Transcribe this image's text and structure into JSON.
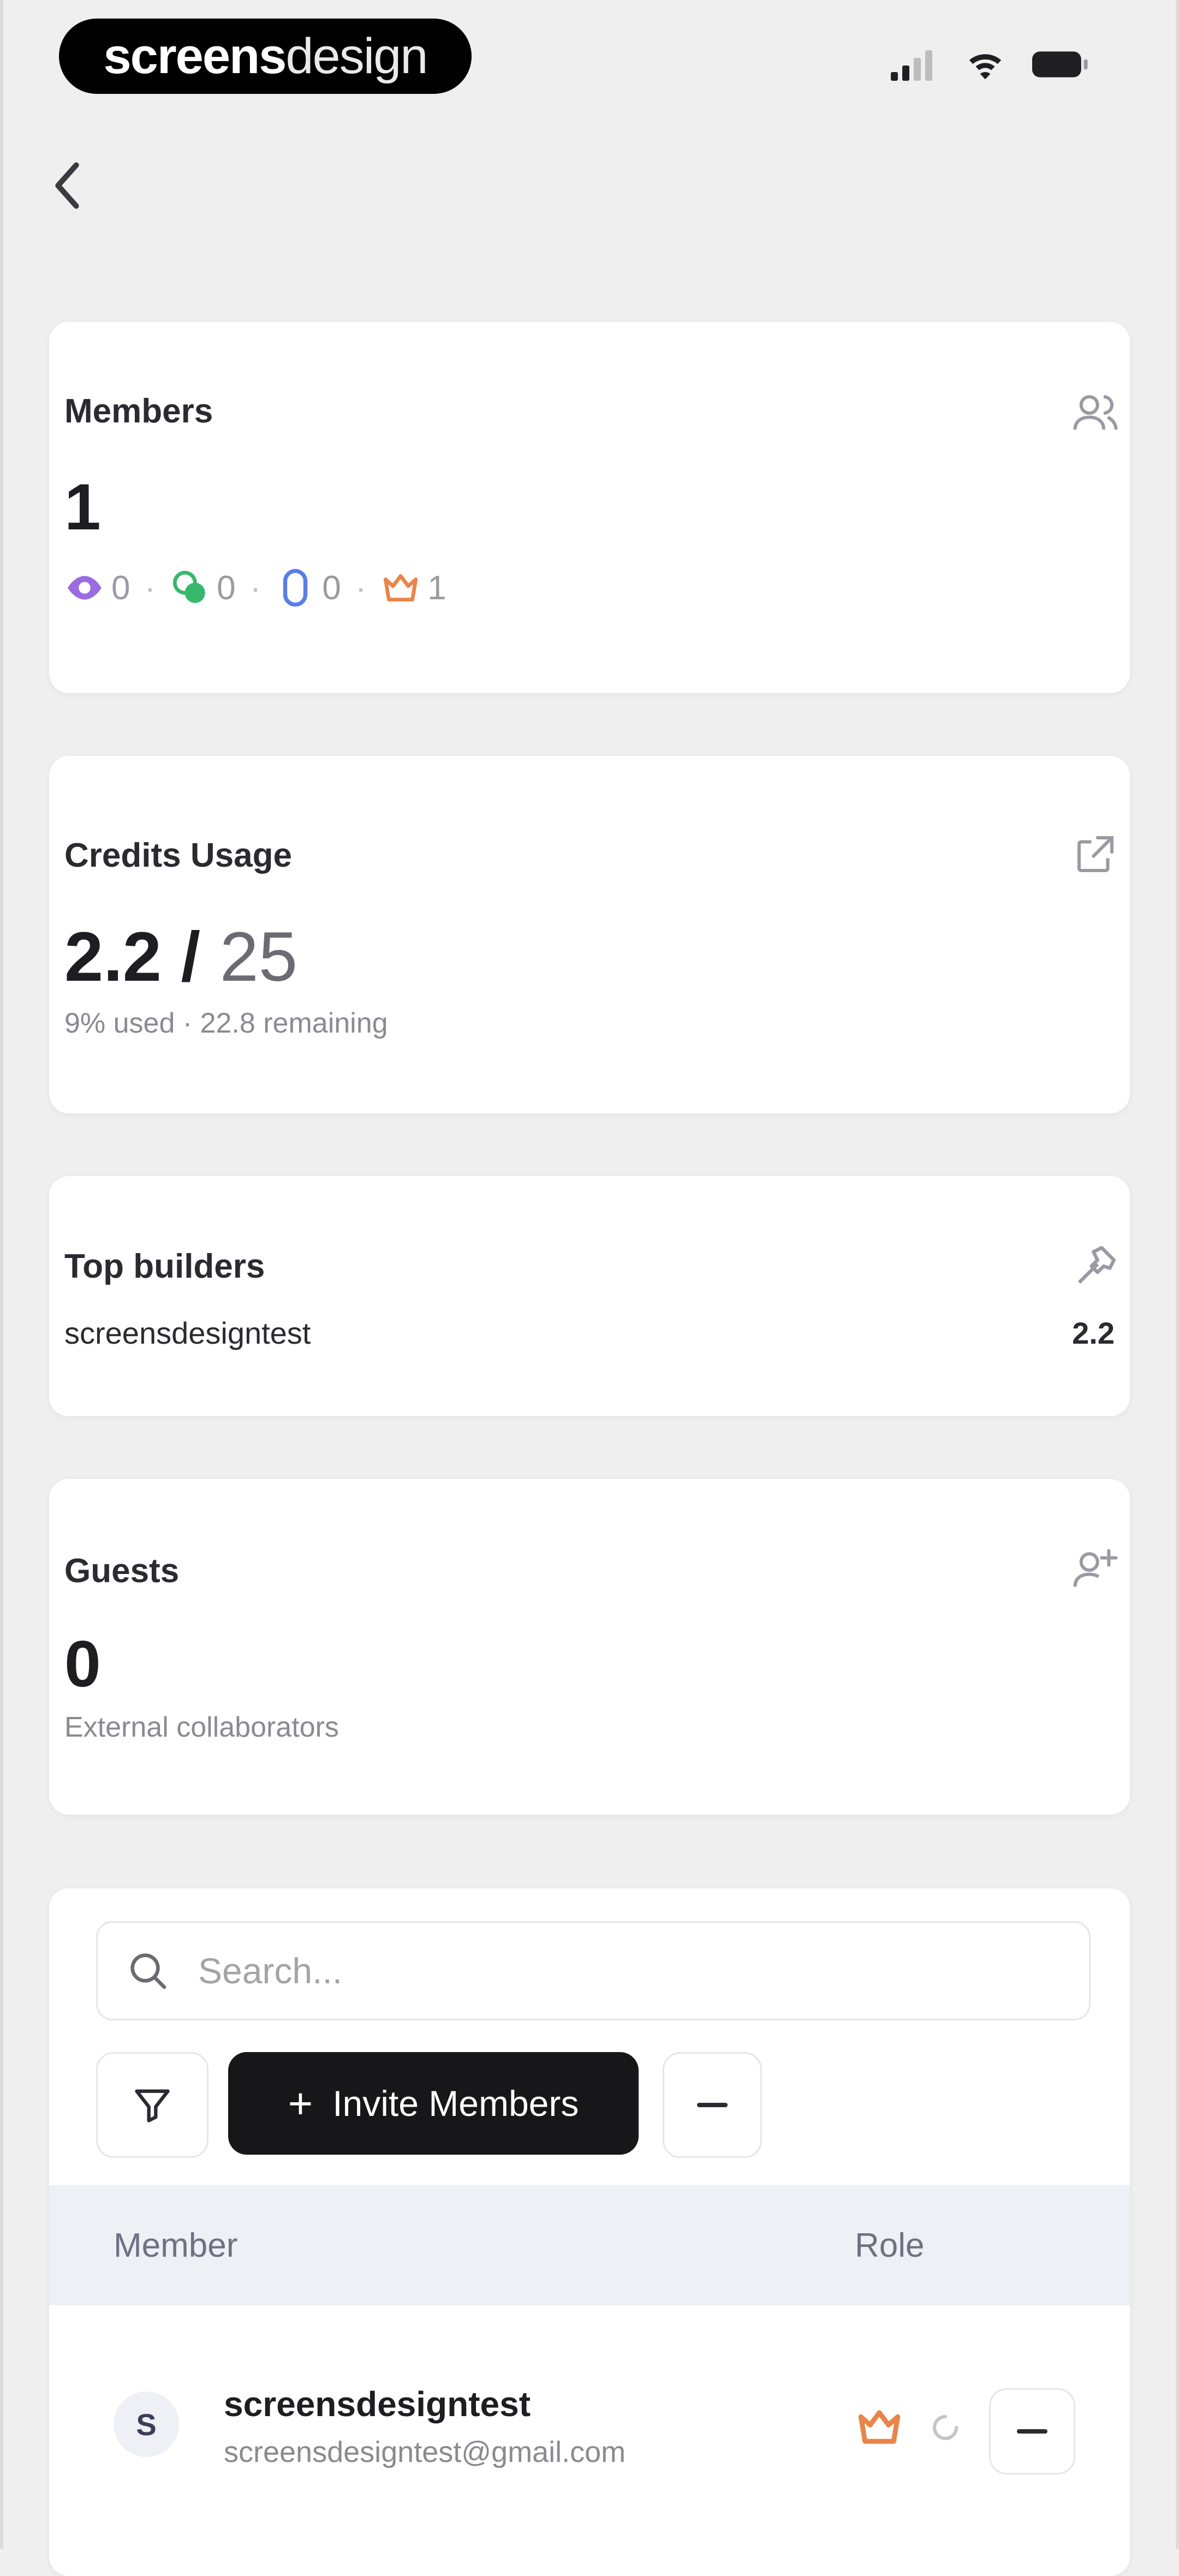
{
  "status_bar": {
    "brand_bold": "screens",
    "brand_light": "design"
  },
  "members_card": {
    "title": "Members",
    "count": "1",
    "roles": [
      {
        "icon": "eye-icon",
        "count": "0",
        "color": "#9b6be0"
      },
      {
        "icon": "edit-icon",
        "count": "0",
        "color": "#37b86b"
      },
      {
        "icon": "shield-icon",
        "count": "0",
        "color": "#5a7ee8"
      },
      {
        "icon": "crown-icon",
        "count": "1",
        "color": "#e8854a"
      }
    ],
    "separator": "·"
  },
  "credits_card": {
    "title": "Credits Usage",
    "used": "2.2",
    "slash": " / ",
    "total": "25",
    "subtitle": "9% used · 22.8 remaining"
  },
  "builders_card": {
    "title": "Top builders",
    "builders": [
      {
        "name": "screensdesigntest",
        "value": "2.2"
      }
    ]
  },
  "guests_card": {
    "title": "Guests",
    "count": "0",
    "subtitle": "External collaborators"
  },
  "members_table": {
    "search_placeholder": "Search...",
    "invite_label": "Invite Members",
    "columns": {
      "member": "Member",
      "role": "Role"
    },
    "rows": [
      {
        "initial": "S",
        "name": "screensdesigntest",
        "email": "screensdesigntest@gmail.com",
        "role_icon": "crown-icon"
      }
    ]
  },
  "colors": {
    "accent_dark": "#17171a",
    "owner_orange": "#e8854a",
    "table_header_bg": "#edf0f5"
  }
}
